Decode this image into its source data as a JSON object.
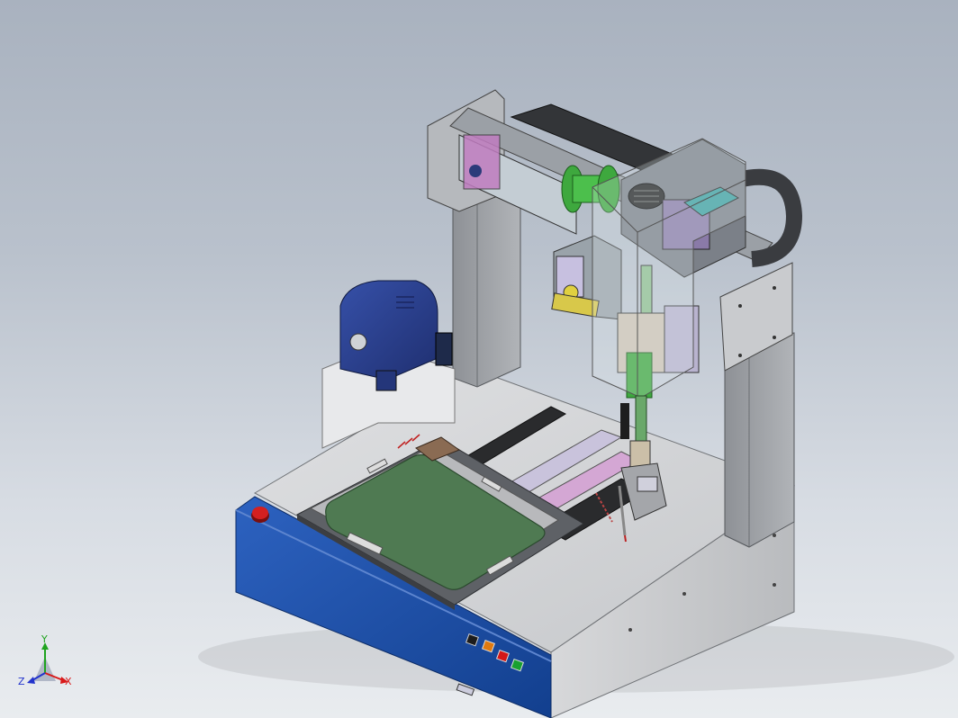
{
  "triad": {
    "y_label": "Y",
    "x_label": "X",
    "z_label": "Z",
    "y_color": "#1fa31f",
    "x_color": "#d91a1a",
    "z_color": "#2233cc"
  },
  "colors": {
    "base_panel_blue": "#1a4fa8",
    "pcb_green": "#4f7a52",
    "frame_gray": "#9ea1a6",
    "guard_glass": "#c8d6dc",
    "motor_blue": "#2b3f8c",
    "emergency_stop": "#d42020"
  },
  "panel_buttons": [
    {
      "name": "indicator-1",
      "color": "#1c1c1c"
    },
    {
      "name": "indicator-2",
      "color": "#e07a10"
    },
    {
      "name": "indicator-3",
      "color": "#d41818"
    },
    {
      "name": "indicator-4",
      "color": "#18a030"
    }
  ]
}
